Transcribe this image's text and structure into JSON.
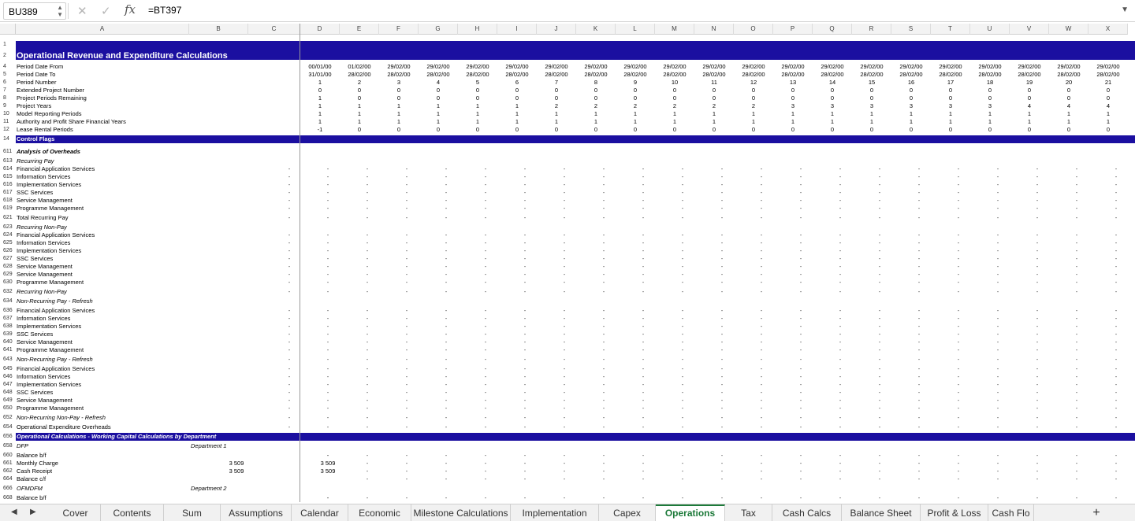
{
  "formula_bar": {
    "cell_ref": "BU389",
    "formula": "=BT397",
    "cancel_icon": "close-icon",
    "enter_icon": "check-icon",
    "fx_label": "fx"
  },
  "columns": [
    "A",
    "B",
    "C",
    "D",
    "E",
    "F",
    "G",
    "H",
    "I",
    "J",
    "K",
    "L",
    "M",
    "N",
    "O",
    "P",
    "Q",
    "R",
    "S",
    "T",
    "U",
    "V",
    "W",
    "X"
  ],
  "rows": [
    {
      "n": "1",
      "label": ""
    },
    {
      "n": "2",
      "label": "Operational Revenue and Expenditure Calculations",
      "type": "title"
    },
    {
      "n": "4",
      "label": "Period Date From",
      "vals": [
        "00/01/00",
        "01/02/00",
        "29/02/00",
        "29/02/00",
        "29/02/00",
        "29/02/00",
        "29/02/00",
        "29/02/00",
        "29/02/00",
        "29/02/00",
        "29/02/00",
        "29/02/00",
        "29/02/00",
        "29/02/00",
        "29/02/00",
        "29/02/00",
        "29/02/00",
        "29/02/00",
        "29/02/00",
        "29/02/00",
        "29/02/00"
      ]
    },
    {
      "n": "5",
      "label": "Period Date To",
      "vals": [
        "31/01/00",
        "28/02/00",
        "28/02/00",
        "28/02/00",
        "28/02/00",
        "28/02/00",
        "28/02/00",
        "28/02/00",
        "28/02/00",
        "28/02/00",
        "28/02/00",
        "28/02/00",
        "28/02/00",
        "28/02/00",
        "28/02/00",
        "28/02/00",
        "28/02/00",
        "28/02/00",
        "28/02/00",
        "28/02/00",
        "28/02/00"
      ]
    },
    {
      "n": "6",
      "label": "Period Number",
      "vals": [
        "1",
        "2",
        "3",
        "4",
        "5",
        "6",
        "7",
        "8",
        "9",
        "10",
        "11",
        "12",
        "13",
        "14",
        "15",
        "16",
        "17",
        "18",
        "19",
        "20",
        "21"
      ]
    },
    {
      "n": "7",
      "label": "Extended Project Number",
      "vals": [
        "0",
        "0",
        "0",
        "0",
        "0",
        "0",
        "0",
        "0",
        "0",
        "0",
        "0",
        "0",
        "0",
        "0",
        "0",
        "0",
        "0",
        "0",
        "0",
        "0",
        "0"
      ]
    },
    {
      "n": "8",
      "label": "Project Periods Remaining",
      "vals": [
        "1",
        "0",
        "0",
        "0",
        "0",
        "0",
        "0",
        "0",
        "0",
        "0",
        "0",
        "0",
        "0",
        "0",
        "0",
        "0",
        "0",
        "0",
        "0",
        "0",
        "0"
      ]
    },
    {
      "n": "9",
      "label": "Project Years",
      "vals": [
        "1",
        "1",
        "1",
        "1",
        "1",
        "1",
        "2",
        "2",
        "2",
        "2",
        "2",
        "2",
        "3",
        "3",
        "3",
        "3",
        "3",
        "3",
        "4",
        "4",
        "4"
      ]
    },
    {
      "n": "10",
      "label": "Model Reporting Periods",
      "vals": [
        "1",
        "1",
        "1",
        "1",
        "1",
        "1",
        "1",
        "1",
        "1",
        "1",
        "1",
        "1",
        "1",
        "1",
        "1",
        "1",
        "1",
        "1",
        "1",
        "1",
        "1"
      ]
    },
    {
      "n": "11",
      "label": "Authority and Profit Share Financial Years",
      "vals": [
        "1",
        "1",
        "1",
        "1",
        "1",
        "1",
        "1",
        "1",
        "1",
        "1",
        "1",
        "1",
        "1",
        "1",
        "1",
        "1",
        "1",
        "1",
        "1",
        "1",
        "1"
      ]
    },
    {
      "n": "12",
      "label": "Lease Rental Periods",
      "vals": [
        "-1",
        "0",
        "0",
        "0",
        "0",
        "0",
        "0",
        "0",
        "0",
        "0",
        "0",
        "0",
        "0",
        "0",
        "0",
        "0",
        "0",
        "0",
        "0",
        "0",
        "0"
      ]
    },
    {
      "n": "14",
      "label": "Control Flags",
      "type": "band"
    },
    {
      "n": "611",
      "label": "Analysis of Overheads",
      "type": "bi"
    },
    {
      "n": "613",
      "label": "Recurring Pay",
      "type": "i"
    },
    {
      "n": "614",
      "label": "Financial Application Services",
      "type": "d"
    },
    {
      "n": "615",
      "label": "Information Services",
      "type": "d"
    },
    {
      "n": "616",
      "label": "Implementation Services",
      "type": "d"
    },
    {
      "n": "617",
      "label": "SSC Services",
      "type": "d"
    },
    {
      "n": "618",
      "label": "Service Management",
      "type": "d"
    },
    {
      "n": "619",
      "label": "Programme Management",
      "type": "d"
    },
    {
      "n": "621",
      "label": "Total Recurring Pay",
      "type": "d"
    },
    {
      "n": "623",
      "label": "Recurring Non-Pay",
      "type": "i"
    },
    {
      "n": "624",
      "label": "Financial Application Services",
      "type": "d"
    },
    {
      "n": "625",
      "label": "Information Services",
      "type": "d"
    },
    {
      "n": "626",
      "label": "Implementation Services",
      "type": "d"
    },
    {
      "n": "627",
      "label": "SSC Services",
      "type": "d"
    },
    {
      "n": "628",
      "label": "Service Management",
      "type": "d"
    },
    {
      "n": "629",
      "label": "Service Management",
      "type": "d"
    },
    {
      "n": "630",
      "label": "Programme Management",
      "type": "d"
    },
    {
      "n": "632",
      "label": "Recurring Non-Pay",
      "type": "di"
    },
    {
      "n": "634",
      "label": "Non-Recurring Pay - Refresh",
      "type": "i"
    },
    {
      "n": "636",
      "label": "Financial Application Services",
      "type": "d"
    },
    {
      "n": "637",
      "label": "Information Services",
      "type": "d"
    },
    {
      "n": "638",
      "label": "Implementation Services",
      "type": "d"
    },
    {
      "n": "639",
      "label": "SSC Services",
      "type": "d"
    },
    {
      "n": "640",
      "label": "Service Management",
      "type": "d"
    },
    {
      "n": "641",
      "label": "Programme Management",
      "type": "d"
    },
    {
      "n": "643",
      "label": "Non-Recurring Pay - Refresh",
      "type": "di"
    },
    {
      "n": "645",
      "label": "Financial Application Services",
      "type": "d"
    },
    {
      "n": "646",
      "label": "Information Services",
      "type": "d"
    },
    {
      "n": "647",
      "label": "Implementation Services",
      "type": "d"
    },
    {
      "n": "648",
      "label": "SSC Services",
      "type": "d"
    },
    {
      "n": "649",
      "label": "Service Management",
      "type": "d"
    },
    {
      "n": "650",
      "label": "Programme Management",
      "type": "d"
    },
    {
      "n": "652",
      "label": "Non-Recurring Non-Pay - Refresh",
      "type": "di"
    },
    {
      "n": "654",
      "label": "Operational Expenditure Overheads",
      "type": "d"
    },
    {
      "n": "656",
      "label": "Operational Calculations - Working Capital Calculations by Department",
      "type": "bandi"
    },
    {
      "n": "658",
      "label": "DFP",
      "type": "i",
      "b": "Department 1"
    },
    {
      "n": "660",
      "label": "Balance b/f",
      "type": "dl",
      "d": "-"
    },
    {
      "n": "661",
      "label": "Monthly Charge",
      "type": "dl",
      "b_val": "3 509",
      "d": "3 509"
    },
    {
      "n": "662",
      "label": "Cash Receipt",
      "type": "dl",
      "b_val": "3 509",
      "d": "3 509"
    },
    {
      "n": "664",
      "label": "Balance c/f",
      "type": "dl"
    },
    {
      "n": "666",
      "label": "OFMDFM",
      "type": "i",
      "b": "Department 2"
    },
    {
      "n": "668",
      "label": "Balance b/f",
      "type": "dl",
      "d": "-"
    }
  ],
  "sheet_tabs": [
    "Cover",
    "Contents",
    "Sum",
    "Assumptions",
    "Calendar",
    "Economic",
    "Milestone Calculations",
    "Implementation",
    "Capex",
    "Operations",
    "Tax",
    "Cash Calcs",
    "Balance Sheet",
    "Profit & Loss",
    "Cash Flo"
  ],
  "active_tab": "Operations",
  "colors": {
    "band": "#1b0fa0",
    "active_tab": "#1d7a3a"
  }
}
